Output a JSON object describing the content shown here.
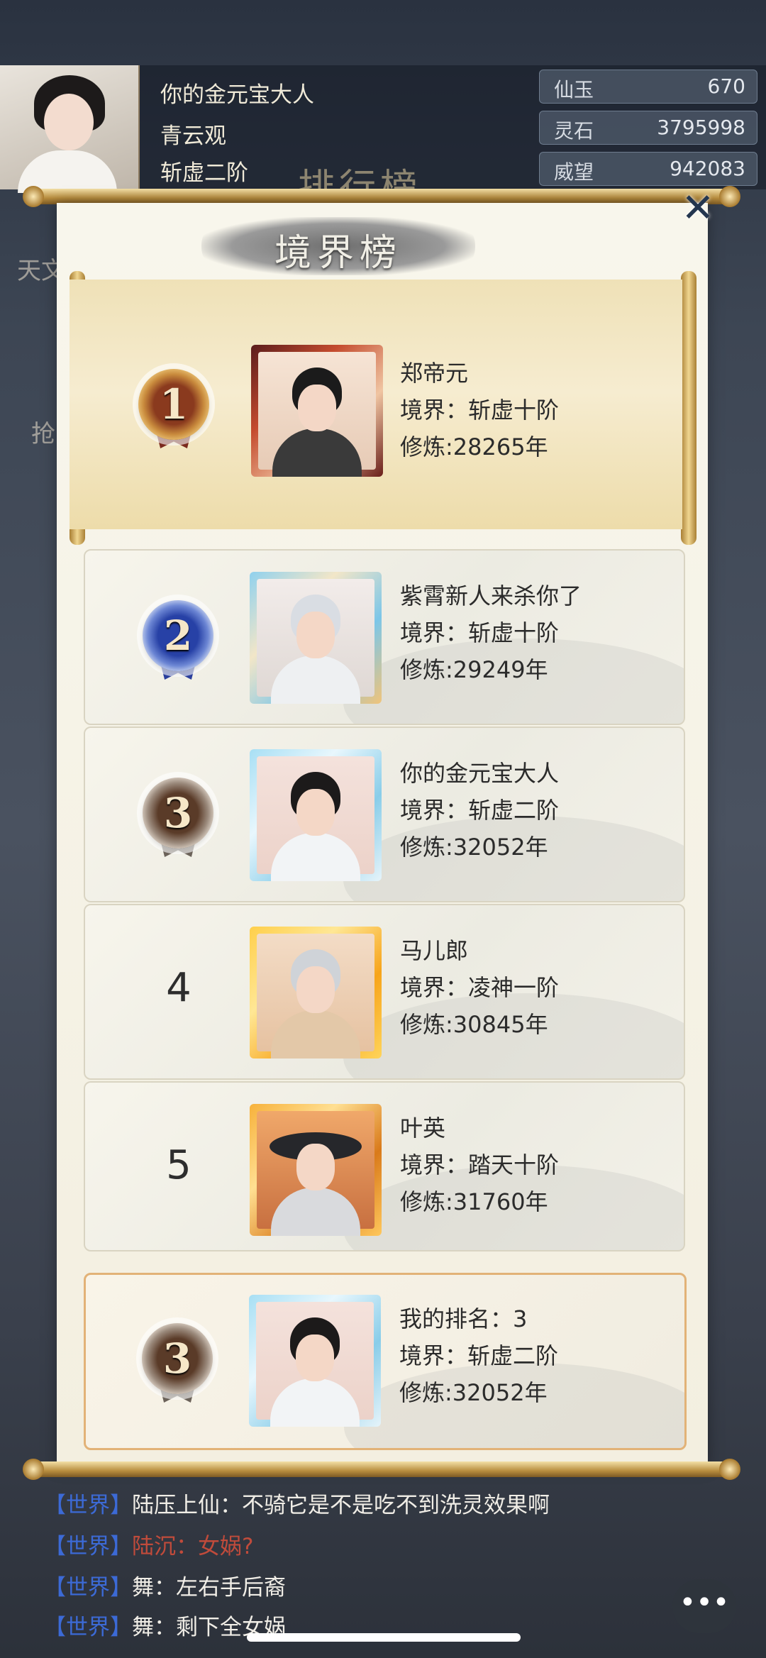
{
  "header": {
    "player_name": "你的金元宝大人",
    "sect": "青云观",
    "realm": "斩虚二阶",
    "background_title": "排行榜",
    "resources": [
      {
        "label": "仙玉",
        "value": "670"
      },
      {
        "label": "灵石",
        "value": "3795998"
      },
      {
        "label": "威望",
        "value": "942083"
      }
    ]
  },
  "modal": {
    "title": "境界榜",
    "close_icon": "close-x-icon"
  },
  "ranks": [
    {
      "rank": "1",
      "name": "郑帝元",
      "realm": "境界：斩虚十阶",
      "cultivation": "修炼:28265年"
    },
    {
      "rank": "2",
      "name": "紫霄新人来杀你了",
      "realm": "境界：斩虚十阶",
      "cultivation": "修炼:29249年"
    },
    {
      "rank": "3",
      "name": "你的金元宝大人",
      "realm": "境界：斩虚二阶",
      "cultivation": "修炼:32052年"
    },
    {
      "rank": "4",
      "name": "马儿郎",
      "realm": "境界：凌神一阶",
      "cultivation": "修炼:30845年"
    },
    {
      "rank": "5",
      "name": "叶英",
      "realm": "境界：踏天十阶",
      "cultivation": "修炼:31760年"
    }
  ],
  "my_rank": {
    "rank": "3",
    "label": "我的排名：3",
    "realm": "境界：斩虚二阶",
    "cultivation": "修炼:32052年"
  },
  "chat": [
    {
      "channel": "【世界】",
      "name": "陆压上仙",
      "message": "：不骑它是不是吃不到洗灵效果啊",
      "highlight": false
    },
    {
      "channel": "【世界】",
      "name": "陆沉",
      "message": "：女娲?",
      "highlight": true
    },
    {
      "channel": "【世界】",
      "name": "舞",
      "message": "：左右手后裔",
      "highlight": false
    },
    {
      "channel": "【世界】",
      "name": "舞",
      "message": "：剩下全女娲",
      "highlight": false
    }
  ],
  "chat_button_icon": "more-dots-icon",
  "side_labels": [
    "天文",
    "抢"
  ]
}
